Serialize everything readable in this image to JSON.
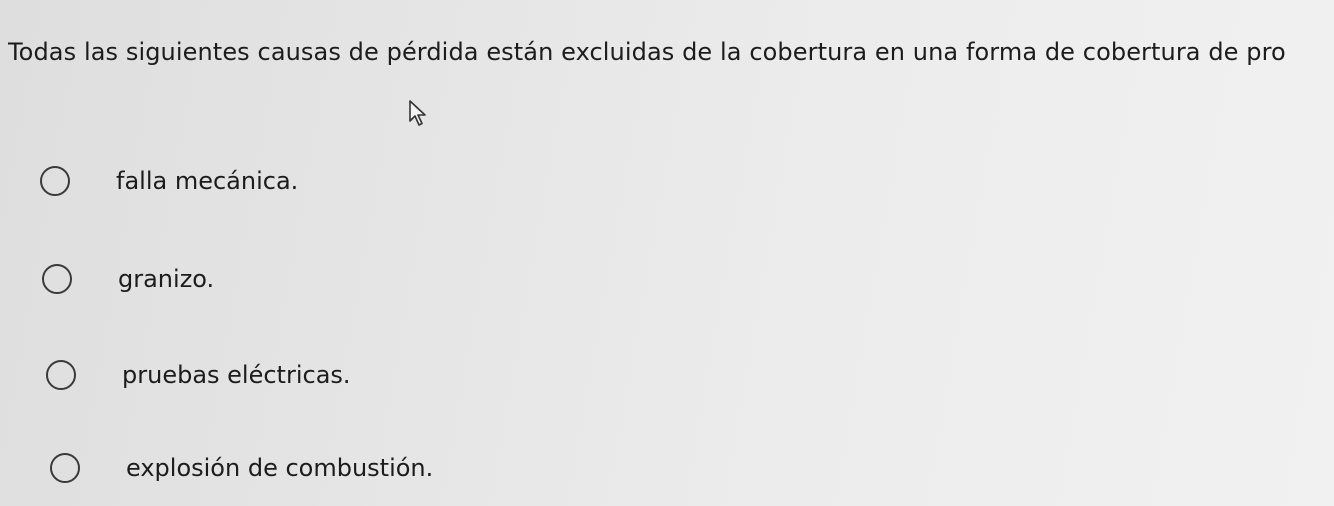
{
  "question": {
    "text": "Todas las siguientes causas de pérdida están excluidas de la cobertura en una forma de cobertura de pro"
  },
  "options": [
    {
      "label": "falla mecánica.",
      "selected": false
    },
    {
      "label": "granizo.",
      "selected": false
    },
    {
      "label": "pruebas eléctricas.",
      "selected": false
    },
    {
      "label": "explosión de combustión.",
      "selected": false
    }
  ]
}
